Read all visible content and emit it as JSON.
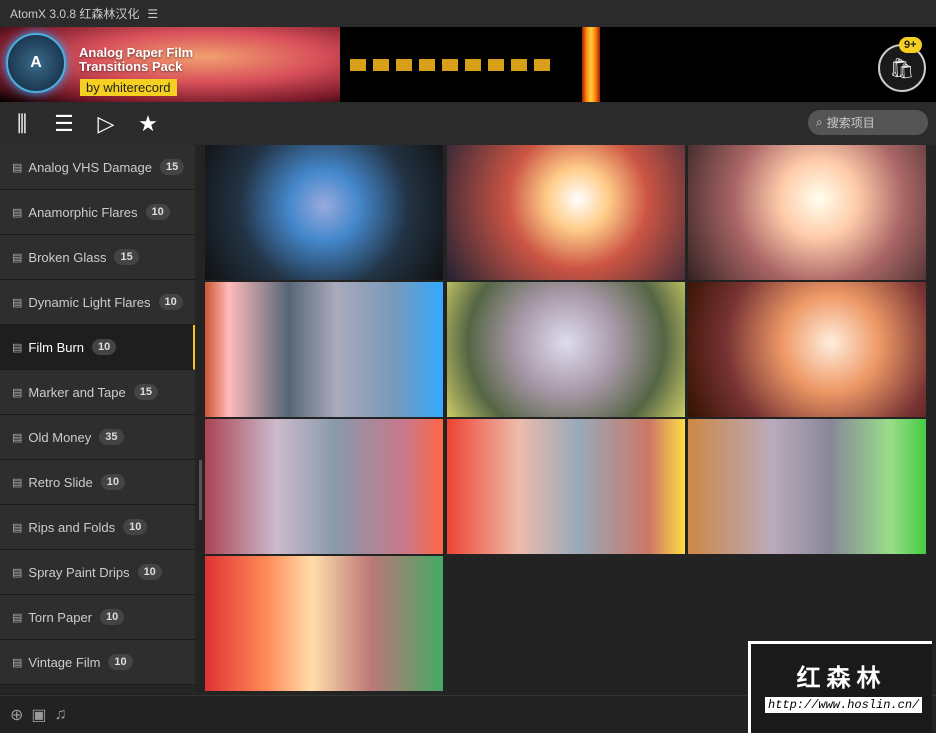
{
  "app": {
    "title": "AtomX 3.0.8 红森林汉化",
    "menu_icon": "hamburger-icon"
  },
  "banner": {
    "title_line1": "Analog Paper Film",
    "title_line2": "Transitions Pack",
    "byline": "by whiterecord",
    "logo_letter": "A",
    "cart_badge": "9+"
  },
  "toolbar": {
    "search_placeholder": "搜索项目"
  },
  "sidebar": {
    "items": [
      {
        "label": "Analog VHS Damage",
        "count": "15"
      },
      {
        "label": "Anamorphic Flares",
        "count": "10"
      },
      {
        "label": "Broken Glass",
        "count": "15"
      },
      {
        "label": "Dynamic Light Flares",
        "count": "10"
      },
      {
        "label": "Film Burn",
        "count": "10",
        "active": true
      },
      {
        "label": "Marker and Tape",
        "count": "15"
      },
      {
        "label": "Old Money",
        "count": "35"
      },
      {
        "label": "Retro Slide",
        "count": "10"
      },
      {
        "label": "Rips and Folds",
        "count": "10"
      },
      {
        "label": "Spray Paint Drips",
        "count": "10"
      },
      {
        "label": "Torn Paper",
        "count": "10"
      },
      {
        "label": "Vintage Film",
        "count": "10"
      }
    ]
  },
  "thumbnail_count": 10,
  "watermark": {
    "title": "红森林",
    "url": "http://www.hoslin.cn/"
  }
}
